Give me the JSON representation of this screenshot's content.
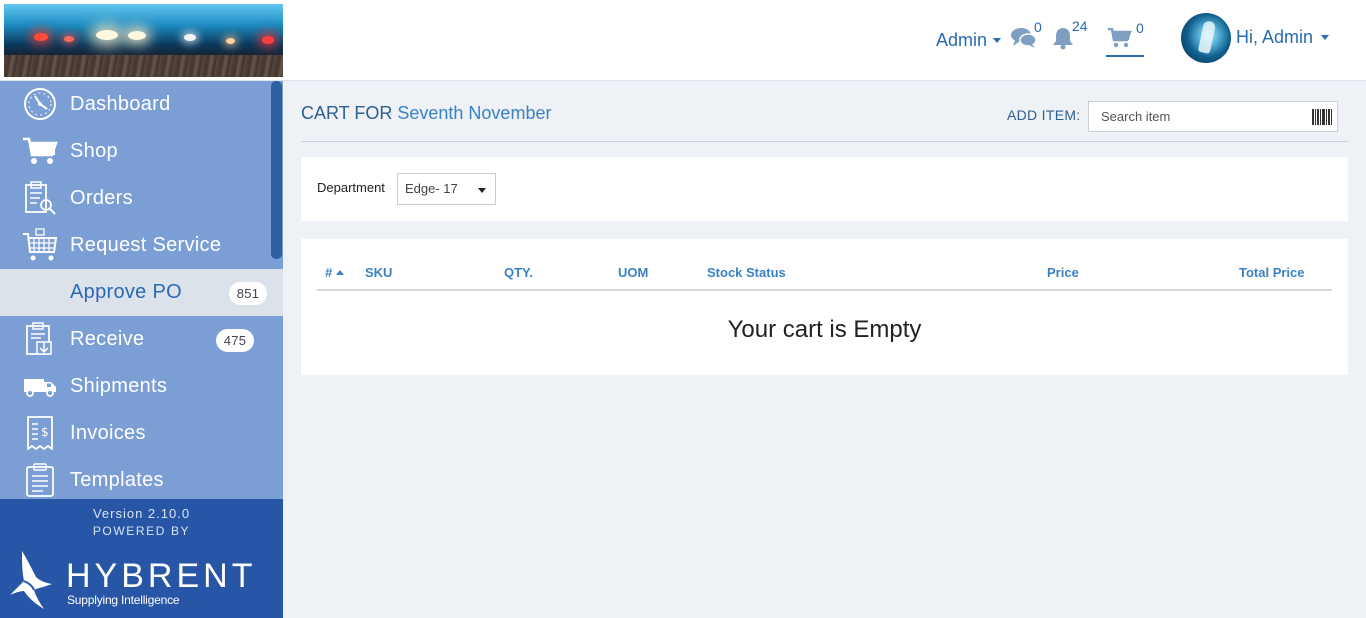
{
  "header": {
    "role_menu_label": "Admin",
    "messages_count": "0",
    "notifications_count": "24",
    "cart_count": "0",
    "greeting": "Hi, Admin"
  },
  "sidebar": {
    "items": [
      {
        "label": "Dashboard",
        "icon": "dashboard-gauge-icon"
      },
      {
        "label": "Shop",
        "icon": "shopping-cart-icon"
      },
      {
        "label": "Orders",
        "icon": "clipboard-search-icon"
      },
      {
        "label": "Request Service",
        "icon": "service-cart-icon"
      },
      {
        "label": "Approve PO",
        "count": "851",
        "active": true
      },
      {
        "label": "Receive",
        "icon": "clipboard-download-icon",
        "count": "475"
      },
      {
        "label": "Shipments",
        "icon": "delivery-truck-icon"
      },
      {
        "label": "Invoices",
        "icon": "invoice-dollar-icon"
      },
      {
        "label": "Templates",
        "icon": "clipboard-list-icon"
      }
    ],
    "footer": {
      "version": "Version 2.10.0",
      "powered_by": "POWERED BY",
      "brand_name": "HYBRENT",
      "brand_tagline": "Supplying Intelligence"
    }
  },
  "main": {
    "title_prefix": "CART FOR",
    "cart_name": "Seventh November",
    "add_item_label": "ADD ITEM:",
    "search_placeholder": "Search item",
    "department_label": "Department",
    "department_value": "Edge- 17",
    "table": {
      "columns": [
        "#",
        "SKU",
        "QTY.",
        "UOM",
        "Stock Status",
        "Price",
        "Total Price"
      ],
      "empty_message": "Your cart is Empty"
    }
  },
  "colors": {
    "accent": "#2a6ab3",
    "link": "#3a82c4",
    "sidebar_bg": "#7b9ed4",
    "sidebar_footer_bg": "#2856a6",
    "page_bg": "#eef1f5"
  }
}
